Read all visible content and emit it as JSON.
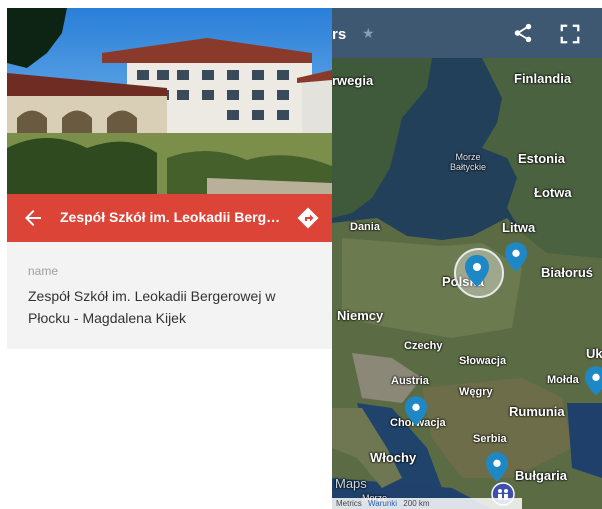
{
  "panel": {
    "title": "Zespół Szkół im. Leokadii Berge…",
    "field_label": "name",
    "field_value": "Zespół Szkół im. Leokadii Bergerowej w Płocku - Magdalena Kijek"
  },
  "map_header": {
    "title_fragment": "rs"
  },
  "map_labels": {
    "norwegia": "rwegia",
    "finlandia": "Finlandia",
    "morze": "Morze",
    "baltyckie": "Bałtyckie",
    "estonia": "Estonia",
    "lotwa": "Łotwa",
    "dania": "Dania",
    "litwa": "Litwa",
    "polska": "Polska",
    "bialorus": "Białoruś",
    "niemcy": "Niemcy",
    "czechy": "Czechy",
    "slowacja": "Słowacja",
    "austria": "Austria",
    "wegry": "Węgry",
    "uk": "Uk",
    "moldawia": "Mołda",
    "rumunia": "Rumunia",
    "chorwacja": "Chorwacja",
    "serbia": "Serbia",
    "wlochy": "Włochy",
    "bulgaria": "Bułgaria",
    "maps": "Maps",
    "morze2": "Morze"
  },
  "scale_bar": {
    "metrics": "Metrics",
    "terms": "Warunki",
    "distance": "200 km"
  },
  "colors": {
    "accent": "#db4437",
    "pin": "#1e88c7"
  }
}
